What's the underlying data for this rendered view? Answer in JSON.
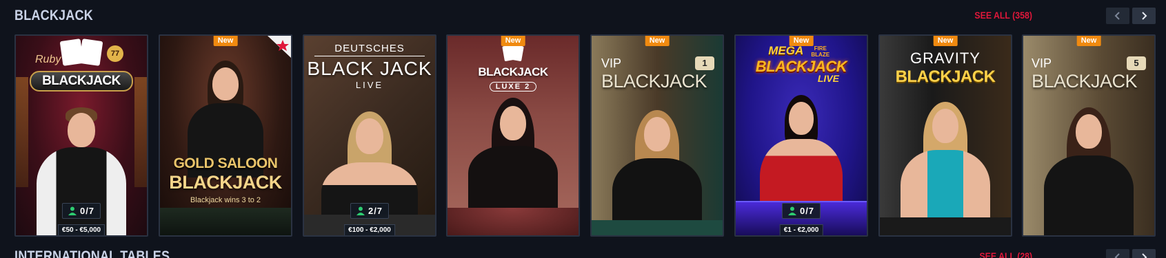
{
  "section": {
    "title": "BLACKJACK",
    "see_all": "SEE ALL (358)"
  },
  "next_section": {
    "title": "INTERNATIONAL TABLES",
    "see_all": "SEE ALL (28)"
  },
  "icons": {
    "prev": "chevron-left-icon",
    "next": "chevron-right-icon",
    "seats": "person-icon",
    "star": "star-icon"
  },
  "colors": {
    "accent": "#e0173a",
    "new_badge": "#f08a10",
    "page_bg": "#0f131c"
  },
  "games": [
    {
      "logo_top": "Ruby",
      "logo_main": "BLACKJACK",
      "logo_badge": "77",
      "seats": "0/7",
      "limits": "€50 - €5,000"
    },
    {
      "badge": "New",
      "logo_top": "GOLD SALOON",
      "logo_main": "BLACKJACK",
      "logo_sub": "Blackjack wins 3 to 2"
    },
    {
      "logo_top": "DEUTSCHES",
      "logo_main": "BLACK JACK",
      "logo_sub": "LIVE",
      "seats": "2/7",
      "limits": "€100 - €2,000"
    },
    {
      "badge": "New",
      "logo_main": "BLACKJACK",
      "logo_sub": "LUXE 2"
    },
    {
      "badge": "New",
      "logo_top": "VIP",
      "logo_main": "BLACKJACK",
      "logo_badge": "1"
    },
    {
      "badge": "New",
      "logo_top": "MEGA",
      "logo_top2": "FIRE BLAZE",
      "logo_main": "BLACKJACK",
      "logo_sub": "LIVE",
      "seats": "0/7",
      "limits": "€1 - €2,000"
    },
    {
      "badge": "New",
      "logo_top": "GRAVITY",
      "logo_main": "BLACKJACK"
    },
    {
      "badge": "New",
      "logo_top": "VIP",
      "logo_main": "BLACKJACK",
      "logo_badge": "5"
    }
  ]
}
